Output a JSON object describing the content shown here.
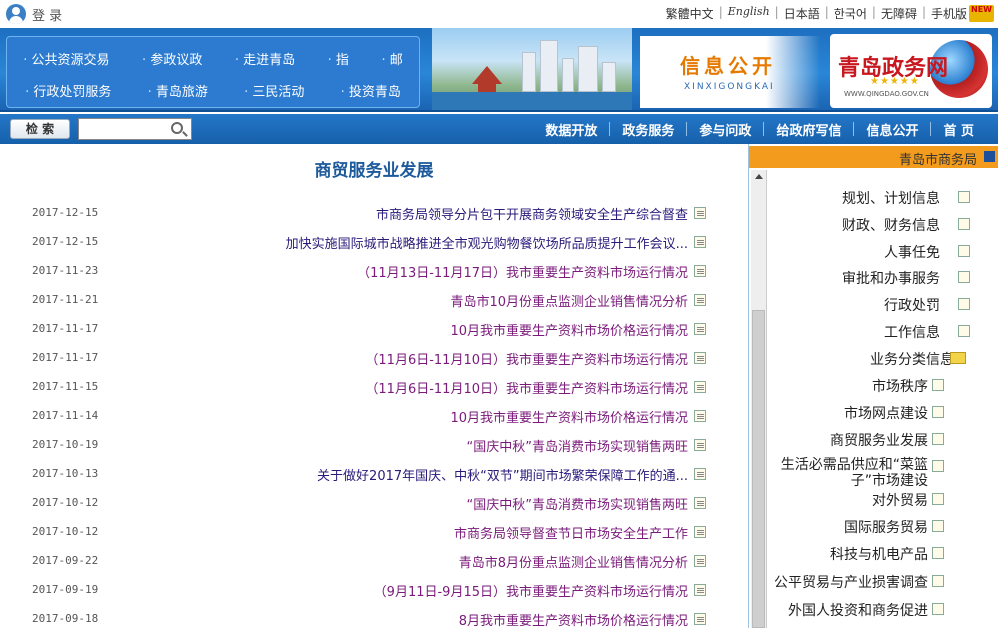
{
  "topbar": {
    "login": "登 录",
    "links": [
      "繁體中文",
      "English",
      "日本語",
      "한국어",
      "无障碍",
      "手机版"
    ],
    "new_badge": "NEW"
  },
  "banner": {
    "nav_row1": [
      "公共资源交易",
      "参政议政",
      "走进青岛",
      "指",
      "邮"
    ],
    "nav_row2": [
      "行政处罚服务",
      "青岛旅游",
      "三民活动",
      "投资青岛"
    ],
    "xxgk_title": "信息公开",
    "xxgk_pinyin": "XINXIGONGKAI",
    "logo_text": "青岛政务网",
    "logo_url": "WWW.QINGDAO.GOV.CN"
  },
  "navbar": {
    "search_button": "检 索",
    "search_placeholder": "",
    "items": [
      "首 页",
      "信息公开",
      "给政府写信",
      "参与问政",
      "政务服务",
      "数据开放"
    ]
  },
  "main": {
    "title": "商贸服务业发展",
    "rows": [
      {
        "text": "市商务局领导分片包干开展商务领域安全生产综合督查",
        "date": "2017-12-15",
        "visited": false
      },
      {
        "text": "加快实施国际城市战略推进全市观光购物餐饮场所品质提升工作会议...",
        "date": "2017-12-15",
        "visited": false
      },
      {
        "text": "（11月13日-11月17日）我市重要生产资料市场运行情况",
        "date": "2017-11-23",
        "visited": true
      },
      {
        "text": "青岛市10月份重点监测企业销售情况分析",
        "date": "2017-11-21",
        "visited": true
      },
      {
        "text": "10月我市重要生产资料市场价格运行情况",
        "date": "2017-11-17",
        "visited": true
      },
      {
        "text": "（11月6日-11月10日）我市重要生产资料市场运行情况",
        "date": "2017-11-17",
        "visited": true
      },
      {
        "text": "（11月6日-11月10日）我市重要生产资料市场运行情况",
        "date": "2017-11-15",
        "visited": true
      },
      {
        "text": "10月我市重要生产资料市场价格运行情况",
        "date": "2017-11-14",
        "visited": true
      },
      {
        "text": "“国庆中秋”青岛消费市场实现销售两旺",
        "date": "2017-10-19",
        "visited": true
      },
      {
        "text": "关于做好2017年国庆、中秋“双节”期间市场繁荣保障工作的通...",
        "date": "2017-10-13",
        "visited": false
      },
      {
        "text": "“国庆中秋”青岛消费市场实现销售两旺",
        "date": "2017-10-12",
        "visited": true
      },
      {
        "text": "市商务局领导督查节日市场安全生产工作",
        "date": "2017-10-12",
        "visited": true
      },
      {
        "text": "青岛市8月份重点监测企业销售情况分析",
        "date": "2017-09-22",
        "visited": true
      },
      {
        "text": "（9月11日-9月15日）我市重要生产资料市场运行情况",
        "date": "2017-09-19",
        "visited": true
      },
      {
        "text": "8月我市重要生产资料市场价格运行情况",
        "date": "2017-09-18",
        "visited": true
      }
    ]
  },
  "sidebar": {
    "header": "青岛市商务局",
    "items": [
      {
        "label": "规划、计划信息",
        "level": "top"
      },
      {
        "label": "财政、财务信息",
        "level": "top"
      },
      {
        "label": "人事任免",
        "level": "top"
      },
      {
        "label": "审批和办事服务",
        "level": "top"
      },
      {
        "label": "行政处罚",
        "level": "top"
      },
      {
        "label": "工作信息",
        "level": "top"
      },
      {
        "label": "业务分类信息",
        "level": "folder"
      },
      {
        "label": "市场秩序",
        "level": "child"
      },
      {
        "label": "市场网点建设",
        "level": "child"
      },
      {
        "label": "商贸服务业发展",
        "level": "child"
      },
      {
        "label": "生活必需品供应和“菜篮子”市场建设",
        "level": "child"
      },
      {
        "label": "对外贸易",
        "level": "child"
      },
      {
        "label": "国际服务贸易",
        "level": "child"
      },
      {
        "label": "科技与机电产品",
        "level": "child"
      },
      {
        "label": "公平贸易与产业损害调查",
        "level": "child"
      },
      {
        "label": "外国人投资和商务促进",
        "level": "child"
      }
    ]
  }
}
